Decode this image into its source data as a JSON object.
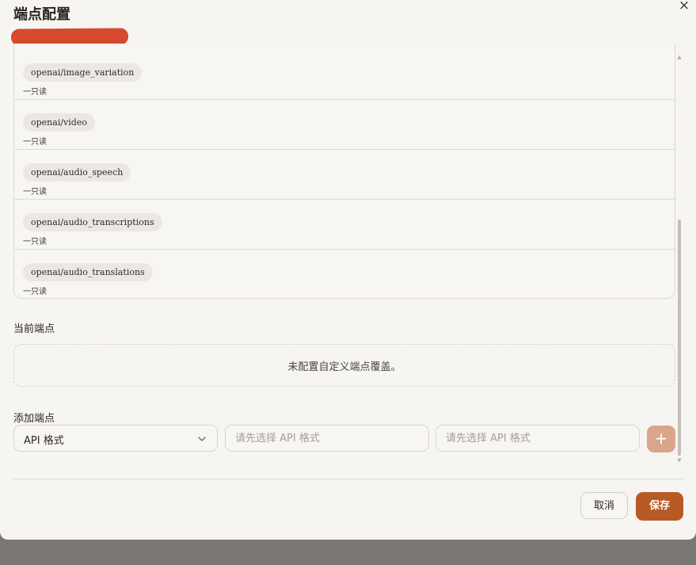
{
  "dialog": {
    "title": "端点配置",
    "close_glyph": "×"
  },
  "endpoint_list": [
    {
      "name": "openai/image_variation",
      "tag": "一只读"
    },
    {
      "name": "openai/video",
      "tag": "一只读"
    },
    {
      "name": "openai/audio_speech",
      "tag": "一只读"
    },
    {
      "name": "openai/audio_transcriptions",
      "tag": "一只读"
    },
    {
      "name": "openai/audio_translations",
      "tag": "一只读"
    }
  ],
  "current": {
    "label": "当前端点",
    "empty_text": "未配置自定义端点覆盖。"
  },
  "add": {
    "label": "添加端点",
    "format_select_value": "API 格式",
    "input1_placeholder": "请先选择 API 格式",
    "input2_placeholder": "请先选择 API 格式",
    "add_glyph": "+"
  },
  "footer": {
    "cancel_label": "取消",
    "save_label": "保存"
  },
  "colors": {
    "accent": "#b85a24",
    "add_button": "#d9a58b",
    "redaction": "#d64a2f"
  }
}
